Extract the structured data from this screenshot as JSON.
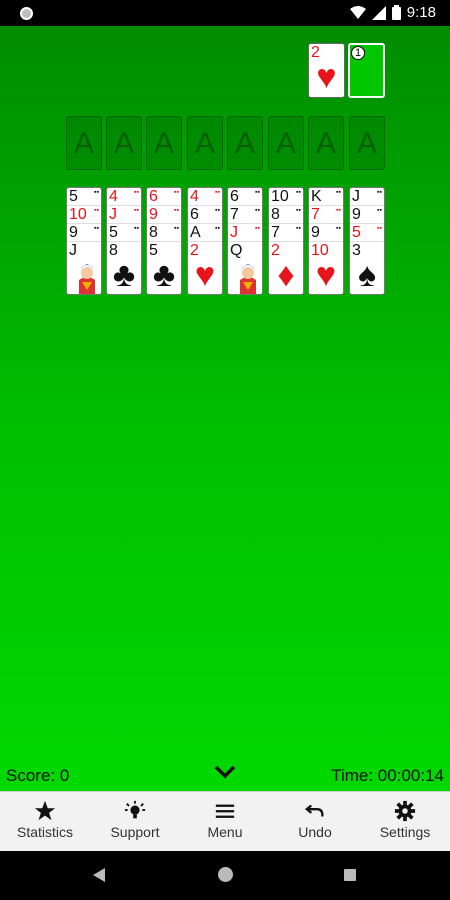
{
  "status_bar": {
    "time": "9:18",
    "icons": [
      "wifi-icon",
      "signal-icon",
      "battery-icon"
    ]
  },
  "waste": {
    "rank": "2",
    "suit": "♥",
    "color": "red"
  },
  "stock": {
    "count": "1"
  },
  "foundations": [
    "A",
    "A",
    "A",
    "A",
    "A",
    "A",
    "A",
    "A"
  ],
  "tableau": [
    {
      "rows": [
        {
          "rank": "5",
          "c": "black"
        },
        {
          "rank": "10",
          "c": "red"
        },
        {
          "rank": "9",
          "c": "black"
        }
      ],
      "bottom": {
        "rank": "J",
        "suit": "♠",
        "c": "black",
        "face": true
      }
    },
    {
      "rows": [
        {
          "rank": "4",
          "c": "red"
        },
        {
          "rank": "J",
          "c": "red"
        },
        {
          "rank": "5",
          "c": "black"
        }
      ],
      "bottom": {
        "rank": "8",
        "suit": "♣",
        "c": "black",
        "face": false
      }
    },
    {
      "rows": [
        {
          "rank": "6",
          "c": "red"
        },
        {
          "rank": "9",
          "c": "red"
        },
        {
          "rank": "8",
          "c": "black"
        }
      ],
      "bottom": {
        "rank": "5",
        "suit": "♣",
        "c": "black",
        "face": false
      }
    },
    {
      "rows": [
        {
          "rank": "4",
          "c": "red"
        },
        {
          "rank": "6",
          "c": "black"
        },
        {
          "rank": "A",
          "c": "black"
        }
      ],
      "bottom": {
        "rank": "2",
        "suit": "♥",
        "c": "red",
        "face": false
      }
    },
    {
      "rows": [
        {
          "rank": "6",
          "c": "black"
        },
        {
          "rank": "7",
          "c": "black"
        },
        {
          "rank": "J",
          "c": "red"
        }
      ],
      "bottom": {
        "rank": "Q",
        "suit": "♣",
        "c": "black",
        "face": true
      }
    },
    {
      "rows": [
        {
          "rank": "10",
          "c": "black"
        },
        {
          "rank": "8",
          "c": "black"
        },
        {
          "rank": "7",
          "c": "black"
        }
      ],
      "bottom": {
        "rank": "2",
        "suit": "♦",
        "c": "red",
        "face": false
      }
    },
    {
      "rows": [
        {
          "rank": "K",
          "c": "black"
        },
        {
          "rank": "7",
          "c": "red"
        },
        {
          "rank": "9",
          "c": "black"
        }
      ],
      "bottom": {
        "rank": "10",
        "suit": "♥",
        "c": "red",
        "face": false
      }
    },
    {
      "rows": [
        {
          "rank": "J",
          "c": "black"
        },
        {
          "rank": "9",
          "c": "black"
        },
        {
          "rank": "5",
          "c": "red"
        }
      ],
      "bottom": {
        "rank": "3",
        "suit": "♠",
        "c": "black",
        "face": false
      }
    }
  ],
  "score": "Score: 0",
  "time": "Time: 00:00:14",
  "toolbar": {
    "statistics": "Statistics",
    "support": "Support",
    "menu": "Menu",
    "undo": "Undo",
    "settings": "Settings"
  },
  "colors": {
    "felt_top": "#008c00",
    "felt_bottom": "#00d900",
    "red_suit": "#e8141b"
  }
}
